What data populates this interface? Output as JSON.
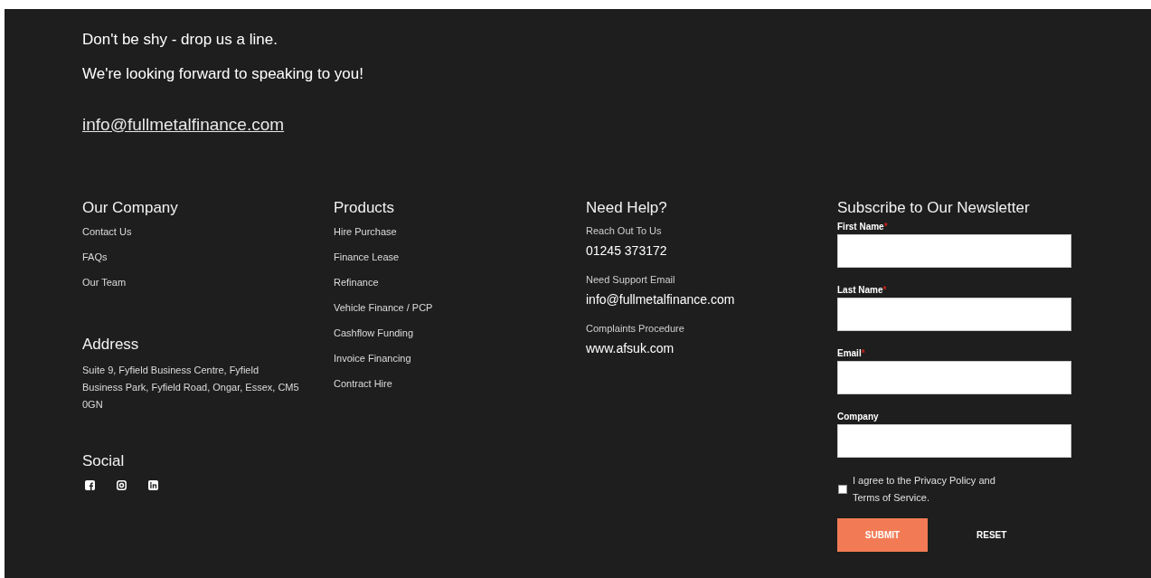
{
  "intro": {
    "lines": [
      "Don't be shy - drop us a line.",
      "We're looking forward to speaking to you!"
    ],
    "email": "info@fullmetalfinance.com"
  },
  "company": {
    "title": "Our Company",
    "links": [
      "Contact Us",
      "FAQs",
      "Our Team"
    ]
  },
  "address": {
    "title": "Address",
    "text": "Suite 9, Fyfield Business Centre, Fyfield Business Park, Fyfield Road, Ongar, Essex, CM5 0GN"
  },
  "social": {
    "title": "Social",
    "icons": [
      {
        "kind": "facebook"
      },
      {
        "kind": "instagram"
      },
      {
        "kind": "linkedin"
      }
    ]
  },
  "products": {
    "title": "Products",
    "links": [
      "Hire Purchase",
      "Finance Lease",
      "Refinance",
      "Vehicle Finance / PCP",
      "Cashflow Funding",
      "Invoice Financing",
      "Contract Hire"
    ]
  },
  "help": {
    "title": "Need Help?",
    "items": [
      {
        "label": "Reach Out To Us",
        "value": "01245 373172"
      },
      {
        "label": "Need Support Email",
        "value": "info@fullmetalfinance.com"
      },
      {
        "label": "Complaints Procedure",
        "value": "www.afsuk.com"
      }
    ]
  },
  "newsletter": {
    "title": "Subscribe to Our Newsletter",
    "fields": [
      {
        "label": "First Name",
        "required_mark": "*"
      },
      {
        "label": "Last Name",
        "required_mark": "*"
      },
      {
        "label": "Email",
        "required_mark": "*"
      },
      {
        "label": "Company"
      }
    ],
    "consent": {
      "text": "I agree to the Privacy Policy and Terms of Service.",
      "checked": false
    },
    "buttons": [
      "SUBMIT",
      "RESET"
    ]
  }
}
